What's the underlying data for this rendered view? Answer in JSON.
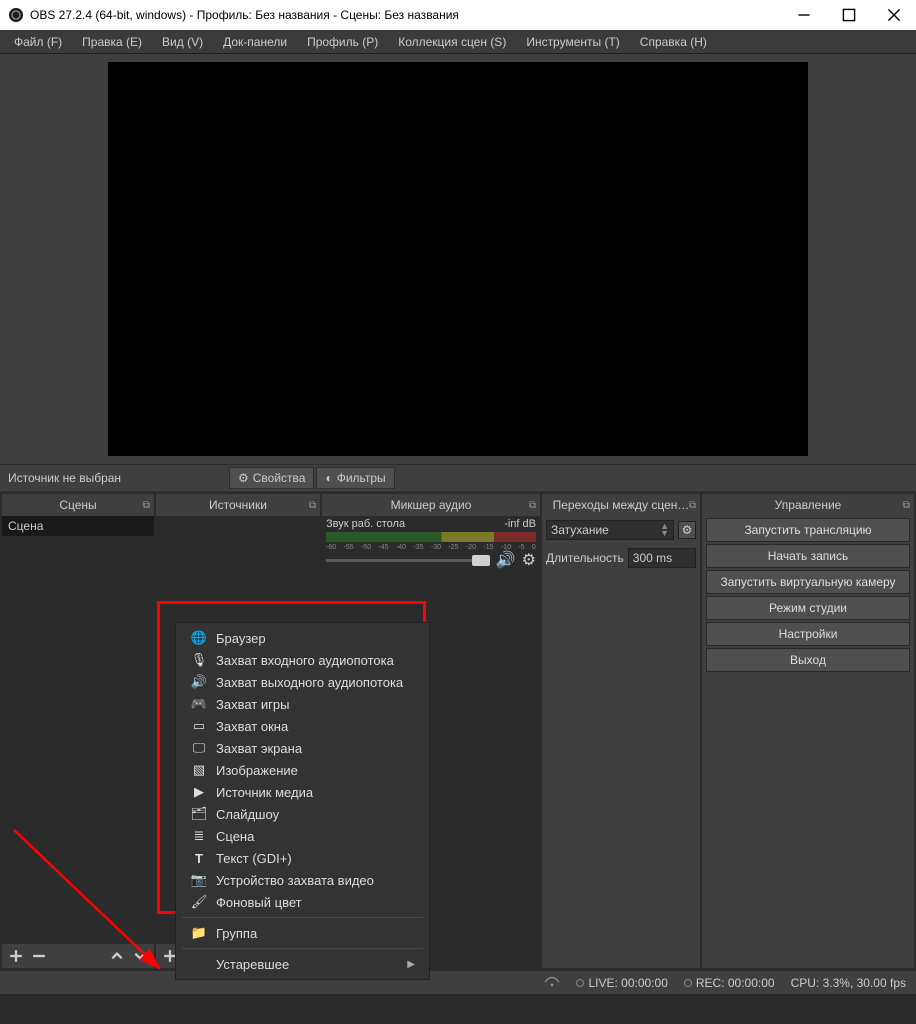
{
  "titlebar": {
    "title": "OBS 27.2.4 (64-bit, windows) - Профиль: Без названия - Сцены: Без названия"
  },
  "menubar": {
    "items": [
      "Файл (F)",
      "Правка (E)",
      "Вид (V)",
      "Док-панели",
      "Профиль (P)",
      "Коллекция сцен (S)",
      "Инструменты (T)",
      "Справка (H)"
    ]
  },
  "src_toolbar": {
    "no_source": "Источник не выбран",
    "props": "Свойства",
    "filters": "Фильтры"
  },
  "docks": {
    "scenes": {
      "title": "Сцены",
      "item": "Сцена"
    },
    "sources": {
      "title": "Источники"
    },
    "mixer": {
      "title": "Микшер аудио",
      "ch_name": "Звук раб. стола",
      "ch_level": "-inf dB",
      "ticks": [
        "-60",
        "-55",
        "-50",
        "-45",
        "-40",
        "-35",
        "-30",
        "-25",
        "-20",
        "-15",
        "-10",
        "-5",
        "0"
      ]
    },
    "transitions": {
      "title": "Переходы между сцен…",
      "selected": "Затухание",
      "duration_label": "Длительность",
      "duration_value": "300 ms"
    },
    "controls": {
      "title": "Управление",
      "buttons": [
        "Запустить трансляцию",
        "Начать запись",
        "Запустить виртуальную камеру",
        "Режим студии",
        "Настройки",
        "Выход"
      ]
    }
  },
  "context_menu": {
    "items": [
      "Браузер",
      "Захват входного аудиопотока",
      "Захват выходного аудиопотока",
      "Захват игры",
      "Захват окна",
      "Захват экрана",
      "Изображение",
      "Источник медиа",
      "Слайдшоу",
      "Сцена",
      "Текст (GDI+)",
      "Устройство захвата видео",
      "Фоновый цвет"
    ],
    "group": "Группа",
    "deprecated": "Устаревшее"
  },
  "statusbar": {
    "live": "LIVE: 00:00:00",
    "rec": "REC: 00:00:00",
    "cpu": "CPU: 3.3%, 30.00 fps"
  }
}
